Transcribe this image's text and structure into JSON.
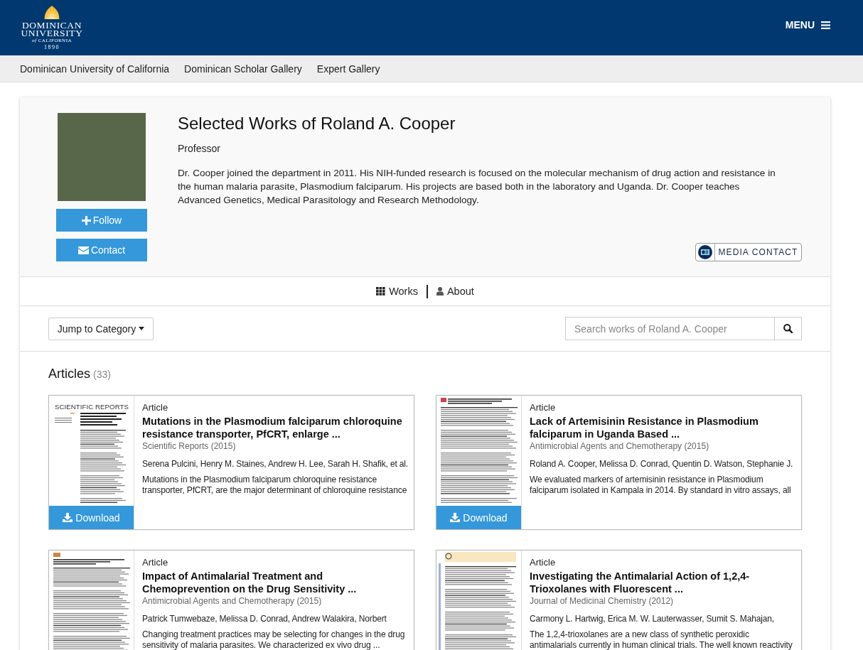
{
  "header": {
    "logo": {
      "lines": [
        "DOMINICAN",
        "UNIVERSITY",
        "*of* CALIFORNIA",
        "1890"
      ]
    },
    "menu": "MENU"
  },
  "breadcrumbs": [
    "Dominican University of California",
    "Dominican Scholar Gallery",
    "Expert Gallery"
  ],
  "profile": {
    "title": "Selected Works of Roland A. Cooper",
    "position": "Professor",
    "bio": "Dr. Cooper joined the department in 2011. His NIH-funded research is focused on the molecular mechanism of drug action and resistance in the human malaria parasite, Plasmodium falciparum. His projects are based both in the laboratory and Uganda. Dr. Cooper teaches Advanced Genetics, Medical Parasitology and Research Methodology.",
    "buttons": [
      {
        "kind": "follow",
        "label": "Follow"
      },
      {
        "kind": "contact",
        "label": "Contact"
      }
    ],
    "media_contact": "MEDIA CONTACT"
  },
  "tabs": [
    {
      "kind": "works",
      "label": "Works"
    },
    {
      "kind": "about",
      "label": "About"
    }
  ],
  "toolbar": {
    "jump": "Jump to Category",
    "search": {
      "placeholder": "Search works of Roland A. Cooper"
    }
  },
  "section": {
    "title": "Articles",
    "count": "(33)"
  },
  "articles": [
    {
      "type": "Article",
      "thumbnail_masthead": "SCIENTIFIC REPORTS",
      "title": [
        "Mutations in the Plasmodium falciparum chloroquine",
        "resistance transporter, PfCRT, enlarge ..."
      ],
      "journal": "Scientific Reports (2015)",
      "authors": "Serena Pulcini, Henry M. Staines, Andrew H. Lee, Sarah H. Shafik, et al.",
      "abstract": [
        "Mutations in the Plasmodium falciparum chloroquine resistance",
        "transporter, PfCRT, are the major determinant of chloroquine resistance"
      ],
      "download": "Download"
    },
    {
      "type": "Article",
      "title": [
        "Lack of Artemisinin Resistance in Plasmodium",
        "falciparum in Uganda Based ..."
      ],
      "journal": "Antimicrobial Agents and Chemotherapy (2015)",
      "authors": "Roland A. Cooper, Melissa D. Conrad, Quentin D. Watson, Stephanie J.",
      "abstract": [
        "We evaluated markers of artemisinin resistance in Plasmodium",
        "falciparum isolated in Kampala in 2014. By standard in vitro assays, all"
      ],
      "download": "Download"
    },
    {
      "type": "Article",
      "title": [
        "Impact of Antimalarial Treatment and",
        "Chemoprevention on the Drug Sensitivity ..."
      ],
      "journal": "Antimicrobial Agents and Chemotherapy (2015)",
      "authors": "Patrick Tumwebaze, Melissa D. Conrad, Andrew Walakira, Norbert",
      "abstract": [
        "Changing treatment practices may be selecting for changes in the drug",
        "sensitivity of malaria parasites. We characterized ex vivo drug ..."
      ]
    },
    {
      "type": "Article",
      "title": [
        "Investigating the Antimalarial Action of 1,2,4-",
        "Trioxolanes with Fluorescent ..."
      ],
      "journal": "Journal of Medicinal Chemistry (2012)",
      "authors": "Carmony L. Hartwig, Erica M. W. Lauterwasser, Sumit S. Mahajan,",
      "abstract": [
        "The 1,2,4-trioxolanes are a new class of synthetic peroxidic",
        "antimalarials currently in human clinical trials. The well known reactivity"
      ]
    }
  ]
}
